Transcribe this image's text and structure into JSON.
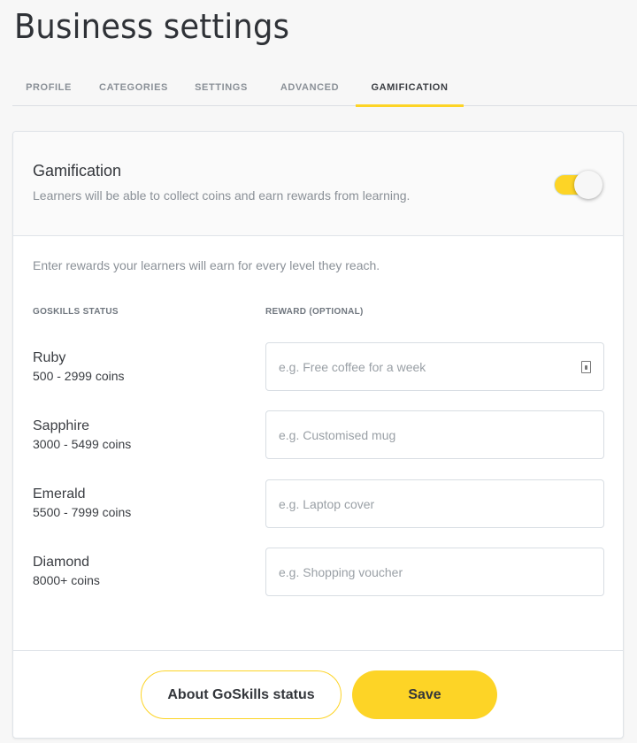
{
  "page": {
    "title": "Business settings"
  },
  "tabs": [
    {
      "label": "PROFILE",
      "active": false
    },
    {
      "label": "CATEGORIES",
      "active": false
    },
    {
      "label": "SETTINGS",
      "active": false
    },
    {
      "label": "ADVANCED",
      "active": false
    },
    {
      "label": "GAMIFICATION",
      "active": true
    }
  ],
  "gamification": {
    "title": "Gamification",
    "description": "Learners will be able to collect coins and earn rewards from learning.",
    "enabled": true,
    "toggle_icon": "toggle-switch-on"
  },
  "rewards": {
    "intro": "Enter rewards your learners will earn for every level they reach.",
    "columns": {
      "status": "GOSKILLS STATUS",
      "reward": "REWARD (OPTIONAL)"
    },
    "levels": [
      {
        "name": "Ruby",
        "range": "500 - 2999 coins",
        "value": "",
        "placeholder": "e.g. Free coffee for a week"
      },
      {
        "name": "Sapphire",
        "range": "3000 - 5499 coins",
        "value": "",
        "placeholder": "e.g. Customised mug"
      },
      {
        "name": "Emerald",
        "range": "5500 - 7999 coins",
        "value": "",
        "placeholder": "e.g. Laptop cover"
      },
      {
        "name": "Diamond",
        "range": "8000+ coins",
        "value": "",
        "placeholder": "e.g. Shopping voucher"
      }
    ],
    "field_icon": "autofill-contact-icon"
  },
  "footer": {
    "about_label": "About GoSkills status",
    "save_label": "Save"
  },
  "colors": {
    "accent": "#fdd426",
    "background": "#f7f7f7",
    "card": "#ffffff",
    "border": "#dfe3e8"
  }
}
